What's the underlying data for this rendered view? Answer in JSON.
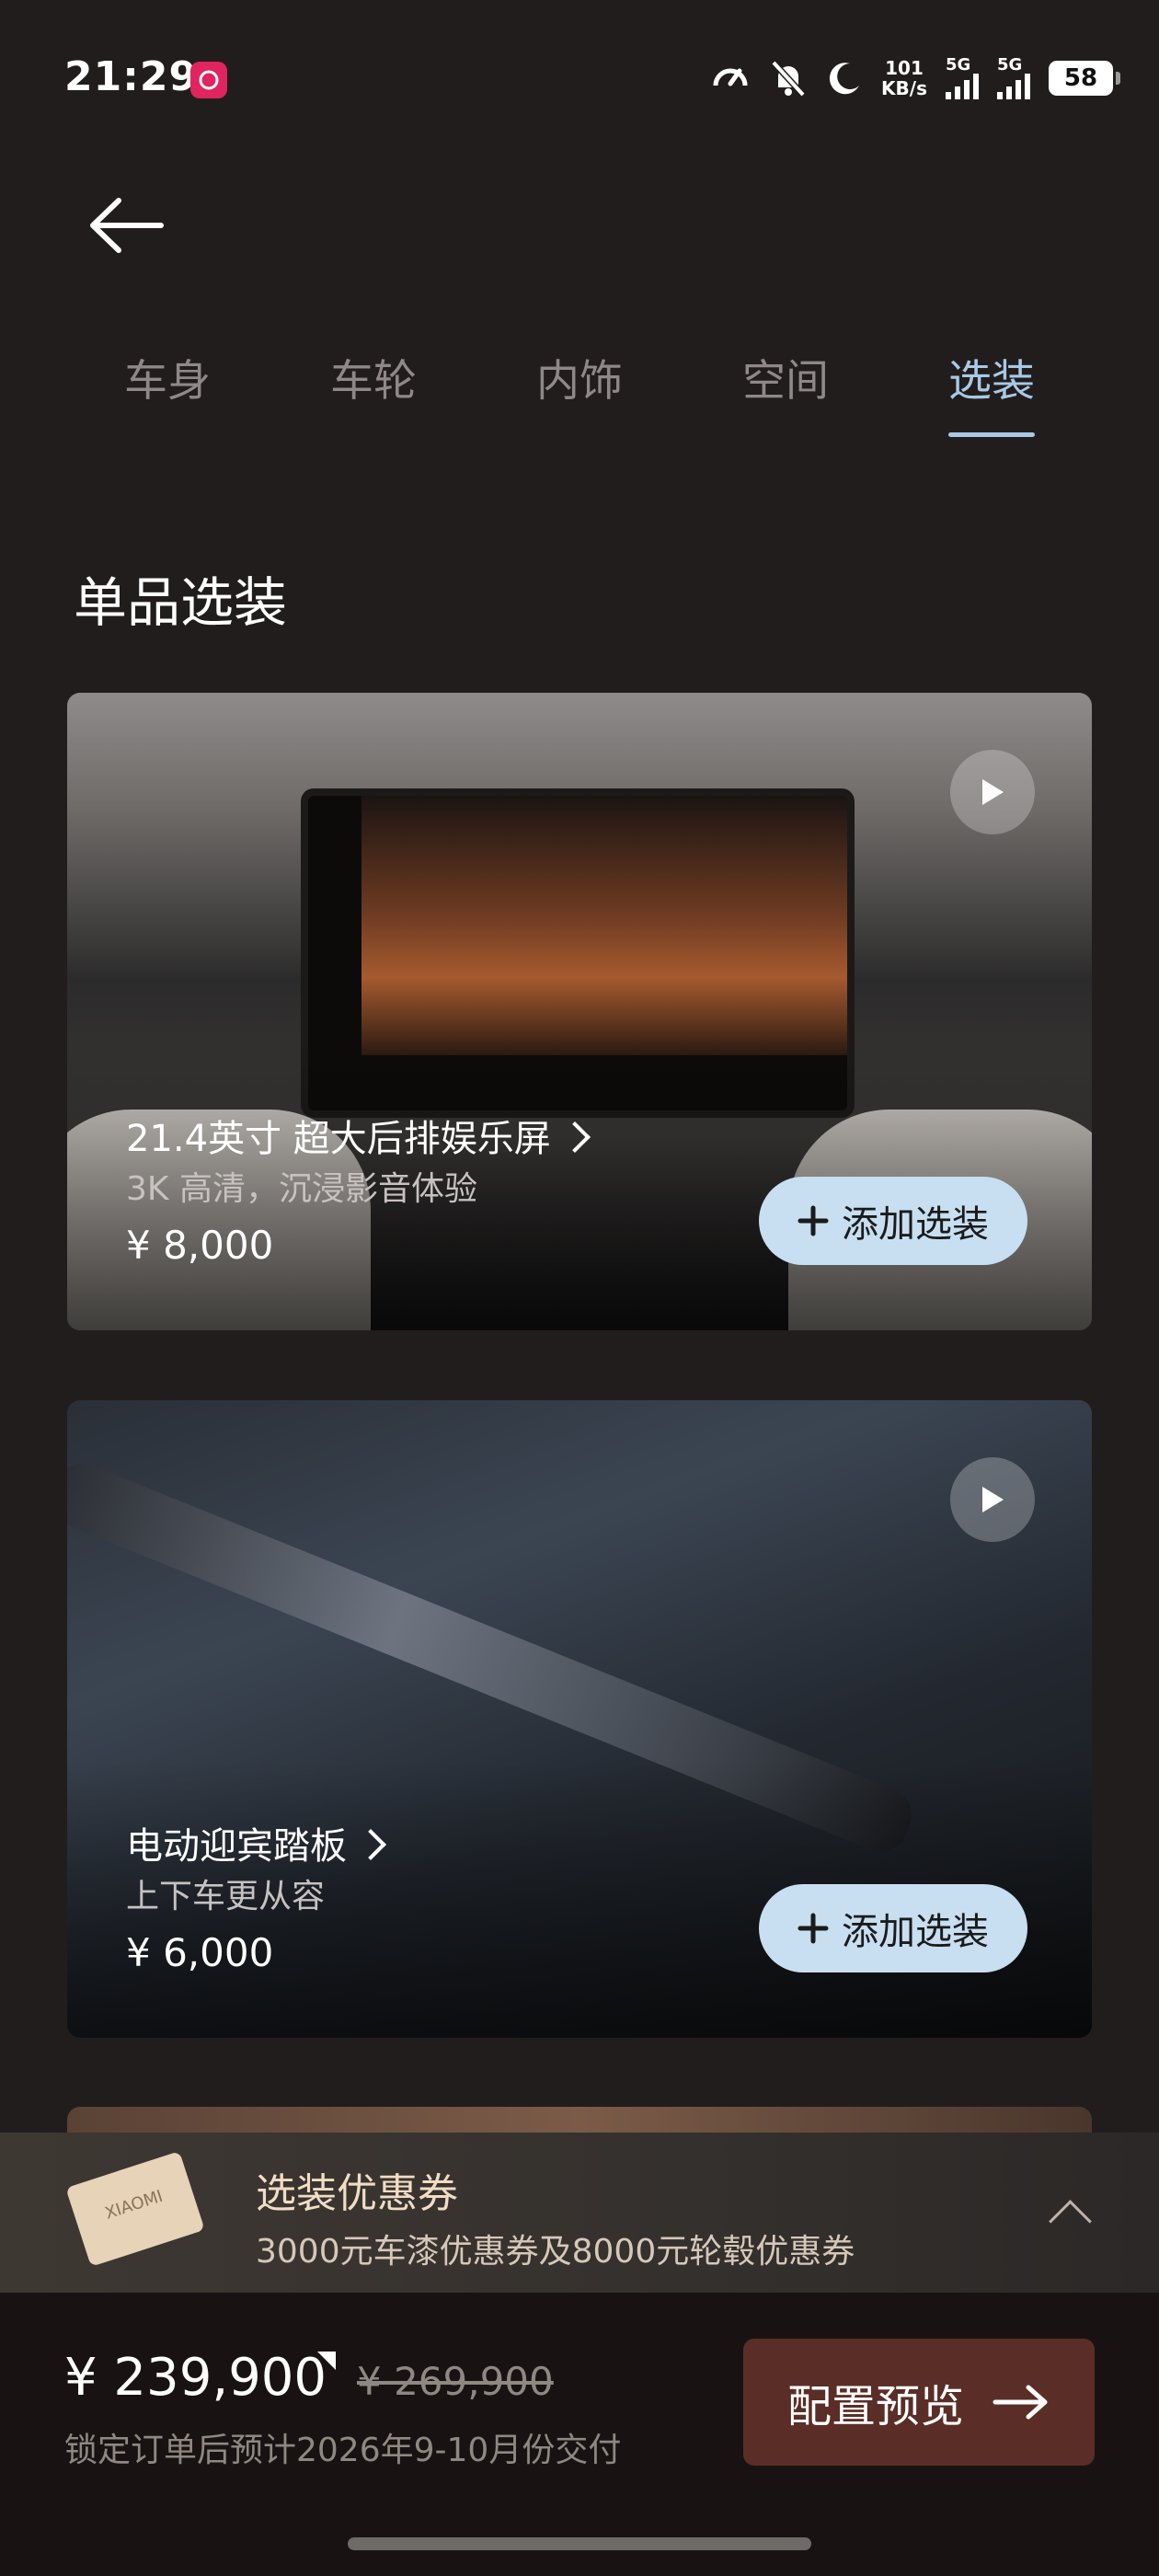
{
  "status_bar": {
    "time": "21:29",
    "speed_value": "101",
    "speed_unit": "KB/s",
    "signal1": "5G",
    "signal2": "5G",
    "battery": "58"
  },
  "tabs": [
    {
      "label": "车身",
      "active": false
    },
    {
      "label": "车轮",
      "active": false
    },
    {
      "label": "内饰",
      "active": false
    },
    {
      "label": "空间",
      "active": false
    },
    {
      "label": "选装",
      "active": true
    }
  ],
  "section_title": "单品选装",
  "options": [
    {
      "title": "21.4英寸 超大后排娱乐屏",
      "subtitle": "3K 高清，沉浸影音体验",
      "price": "¥ 8,000",
      "button": "添加选装"
    },
    {
      "title": "电动迎宾踏板",
      "subtitle": "上下车更从容",
      "price": "¥ 6,000",
      "button": "添加选装"
    }
  ],
  "coupon": {
    "title": "选装优惠券",
    "description": "3000元车漆优惠券及8000元轮毂优惠券",
    "ticket_text": "XIAOMI"
  },
  "footer": {
    "price": "¥ 239,900",
    "original_price": "¥ 269,900",
    "delivery_note": "锁定订单后预计2026年9-10月份交付",
    "preview_button": "配置预览"
  },
  "colors": {
    "background": "#221d1d",
    "active_tab": "#a9c9e4",
    "add_button": "#c7dff0",
    "preview_button": "#5a2e26"
  }
}
